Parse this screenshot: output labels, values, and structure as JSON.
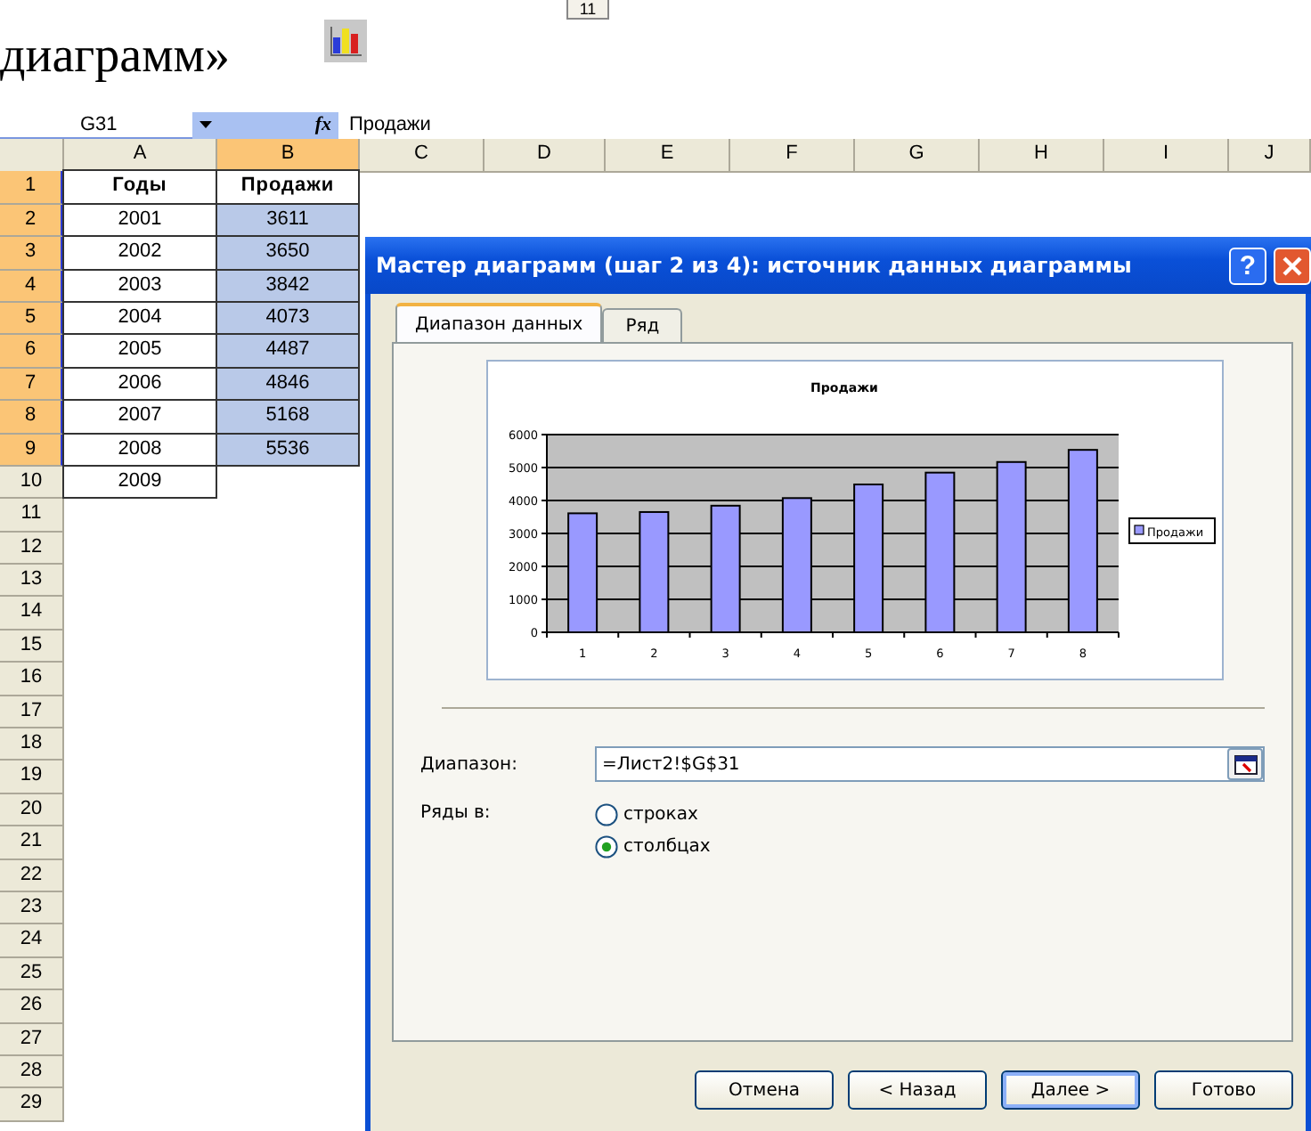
{
  "document": {
    "heading": "диаграмм»",
    "top_cell": "11"
  },
  "formula_bar": {
    "name_box": "G31",
    "function_label": "fx",
    "formula": "Продажи"
  },
  "sheet": {
    "columns": [
      {
        "label": "A",
        "selected": false
      },
      {
        "label": "B",
        "selected": true
      },
      {
        "label": "C",
        "selected": false
      },
      {
        "label": "D",
        "selected": false
      },
      {
        "label": "E",
        "selected": false
      },
      {
        "label": "F",
        "selected": false
      },
      {
        "label": "G",
        "selected": false
      },
      {
        "label": "H",
        "selected": false
      },
      {
        "label": "I",
        "selected": false
      },
      {
        "label": "J",
        "selected": false
      }
    ],
    "rows": [
      {
        "number": "1",
        "selected": true,
        "kind": "header",
        "cells": [
          {
            "text": "Годы",
            "selected": false
          },
          {
            "text": "Продажи",
            "selected": false
          }
        ]
      },
      {
        "number": "2",
        "selected": true,
        "kind": "data",
        "cells": [
          {
            "text": "2001",
            "selected": false
          },
          {
            "text": "3611",
            "selected": true
          }
        ]
      },
      {
        "number": "3",
        "selected": true,
        "kind": "data",
        "cells": [
          {
            "text": "2002",
            "selected": false
          },
          {
            "text": "3650",
            "selected": true
          }
        ]
      },
      {
        "number": "4",
        "selected": true,
        "kind": "data",
        "cells": [
          {
            "text": "2003",
            "selected": false
          },
          {
            "text": "3842",
            "selected": true
          }
        ]
      },
      {
        "number": "5",
        "selected": true,
        "kind": "data",
        "cells": [
          {
            "text": "2004",
            "selected": false
          },
          {
            "text": "4073",
            "selected": true
          }
        ]
      },
      {
        "number": "6",
        "selected": true,
        "kind": "data",
        "cells": [
          {
            "text": "2005",
            "selected": false
          },
          {
            "text": "4487",
            "selected": true
          }
        ]
      },
      {
        "number": "7",
        "selected": true,
        "kind": "data",
        "cells": [
          {
            "text": "2006",
            "selected": false
          },
          {
            "text": "4846",
            "selected": true
          }
        ]
      },
      {
        "number": "8",
        "selected": true,
        "kind": "data",
        "cells": [
          {
            "text": "2007",
            "selected": false
          },
          {
            "text": "5168",
            "selected": true
          }
        ]
      },
      {
        "number": "9",
        "selected": true,
        "kind": "data",
        "cells": [
          {
            "text": "2008",
            "selected": false
          },
          {
            "text": "5536",
            "selected": true
          }
        ]
      },
      {
        "number": "10",
        "selected": false,
        "kind": "data",
        "cells": [
          {
            "text": "2009",
            "selected": false
          }
        ]
      },
      {
        "number": "11",
        "selected": false
      },
      {
        "number": "12",
        "selected": false
      },
      {
        "number": "13",
        "selected": false
      },
      {
        "number": "14",
        "selected": false
      },
      {
        "number": "15",
        "selected": false
      },
      {
        "number": "16",
        "selected": false
      },
      {
        "number": "17",
        "selected": false
      },
      {
        "number": "18",
        "selected": false
      },
      {
        "number": "19",
        "selected": false
      },
      {
        "number": "20",
        "selected": false
      },
      {
        "number": "21",
        "selected": false
      },
      {
        "number": "22",
        "selected": false
      },
      {
        "number": "23",
        "selected": false
      },
      {
        "number": "24",
        "selected": false
      },
      {
        "number": "25",
        "selected": false
      },
      {
        "number": "26",
        "selected": false
      },
      {
        "number": "27",
        "selected": false
      },
      {
        "number": "28",
        "selected": false
      },
      {
        "number": "29",
        "selected": false
      }
    ]
  },
  "dialog": {
    "title": "Мастер диаграмм (шаг 2 из 4): источник данных диаграммы",
    "help_label": "?",
    "tabs": [
      {
        "label": "Диапазон данных",
        "selected": true
      },
      {
        "label": "Ряд",
        "selected": false
      }
    ],
    "chart_data": {
      "type": "bar",
      "title": "Продажи",
      "categories": [
        "1",
        "2",
        "3",
        "4",
        "5",
        "6",
        "7",
        "8"
      ],
      "series": [
        {
          "name": "Продажи",
          "color": "#9999ff",
          "values": [
            3611,
            3650,
            3842,
            4073,
            4487,
            4846,
            5168,
            5536
          ]
        }
      ],
      "ylim": [
        0,
        6000
      ],
      "grid": true,
      "yticks": [
        0,
        1000,
        2000,
        3000,
        4000,
        5000,
        6000
      ]
    },
    "range": {
      "label": "Диапазон:",
      "value": "=Лист2!$G$31"
    },
    "series_in": {
      "label": "Ряды в:",
      "options": [
        {
          "label": "строках",
          "selected": false
        },
        {
          "label": "столбцах",
          "selected": true
        }
      ]
    },
    "buttons": [
      {
        "label": "Отмена",
        "default": false
      },
      {
        "label": "< Назад",
        "default": false
      },
      {
        "label": "Далее >",
        "default": true
      },
      {
        "label": "Готово",
        "default": false
      }
    ]
  }
}
